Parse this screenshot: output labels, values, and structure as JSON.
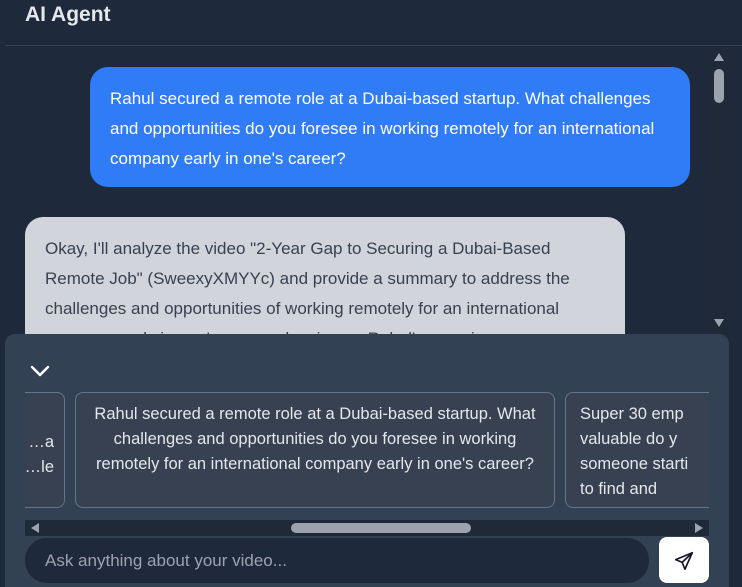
{
  "app": {
    "title": "AI Agent"
  },
  "chat": {
    "user_message": "Rahul secured a remote role at a Dubai-based startup. What challenges and opportunities do you foresee in working remotely for an international company early in one's career?",
    "agent_message": "Okay, I'll analyze the video \"2-Year Gap to Securing a Dubai-Based Remote Job\" (SweexyXMYYc) and provide a summary to address the challenges and opportunities of working remotely for an international company early in one's career, drawing on Rahul's experience."
  },
  "suggestions": [
    "…a\n…le",
    "Rahul secured a remote role at a Dubai-based startup. What challenges and opportunities do you foresee in working remotely for an international company early in one's career?",
    "Super 30 emp\nvaluable do y\nsomeone starti\nto find and"
  ],
  "input": {
    "placeholder": "Ask anything about your video..."
  },
  "icons": {
    "collapse": "chevron-down-icon",
    "send": "send-icon"
  },
  "colors": {
    "background": "#1e293b",
    "user_bubble": "#2f7cf6",
    "agent_bubble": "#d1d5db",
    "panel": "#334155"
  }
}
